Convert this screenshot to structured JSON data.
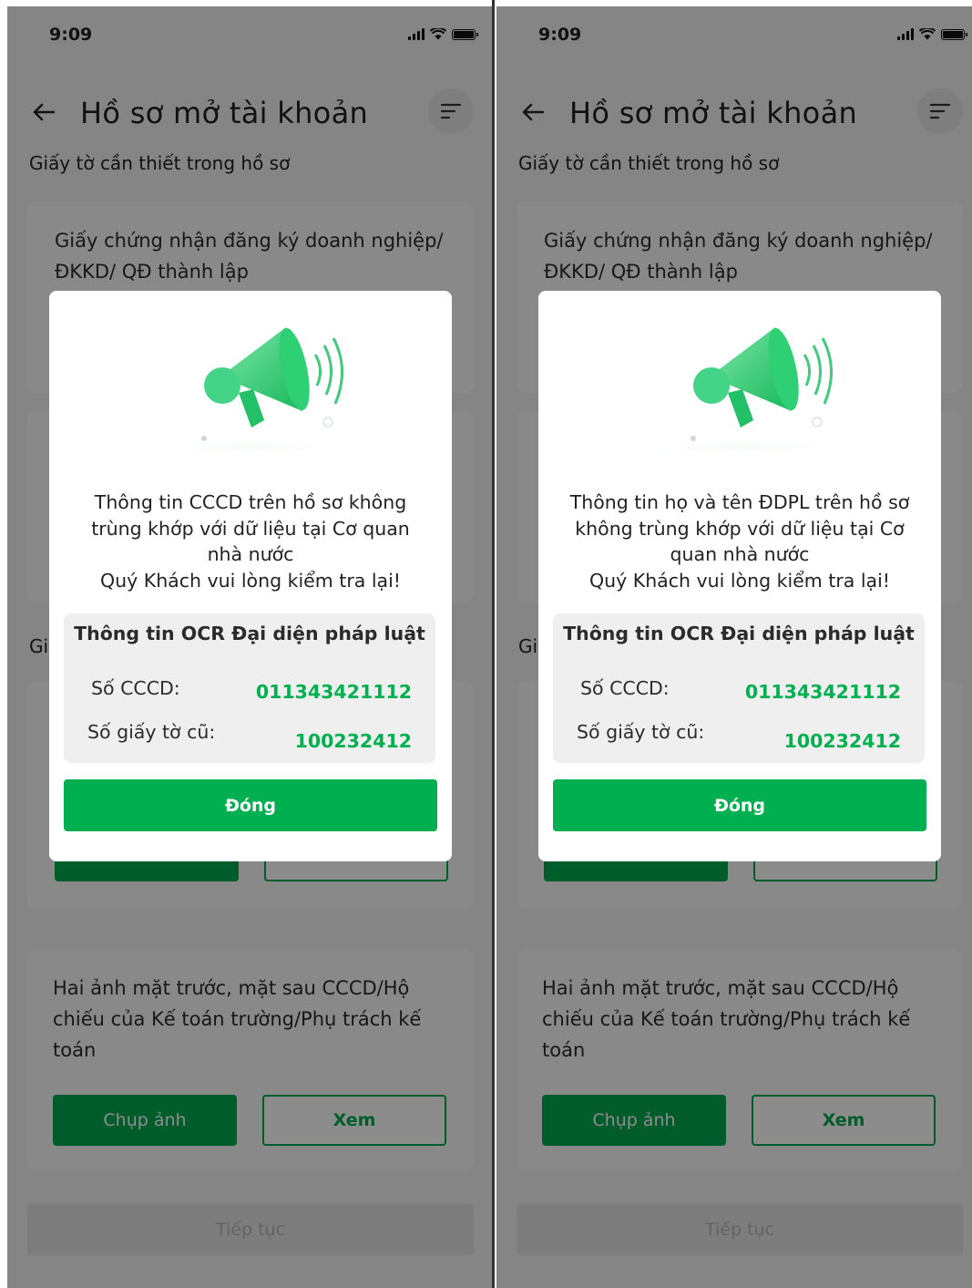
{
  "status": {
    "time": "9:09"
  },
  "header": {
    "title": "Hồ sơ mở tài khoản"
  },
  "section_label": "Giấy tờ cần thiết trong hồ sơ",
  "cards": [
    {
      "text": "Giấy chứng nhận đăng ký doanh nghiệp/ ĐKKD/ QĐ thành lập"
    },
    {
      "text": "Hai ảnh mặt trước, mặt sau CCCD/Hộ chiếu của Kế toán trường/Phụ trách kế toán",
      "capture_label": "Chụp ảnh",
      "view_label": "Xem"
    }
  ],
  "section_label_2_partial": "Gi",
  "continue_label": "Tiếp tục",
  "colors": {
    "primary": "#00b050",
    "dark_primary": "#00a84f"
  },
  "modals": {
    "left": {
      "message_lines": [
        "Thông tin CCCD trên hồ sơ không",
        "trùng khớp với dữ liệu tại Cơ quan",
        "nhà nước",
        "Quý Khách vui lòng kiểm tra lại!"
      ]
    },
    "right": {
      "message_lines": [
        "Thông tin họ và tên ĐDPL trên hồ sơ",
        "không trùng khớp với dữ liệu tại Cơ",
        "quan nhà nước",
        "Quý Khách vui lòng kiểm tra lại!"
      ]
    },
    "info_title": "Thông tin OCR Đại diện pháp luật",
    "cccd_label": "Số CCCD:",
    "cccd_value": "011343421112",
    "old_doc_label": "Số giấy tờ cũ:",
    "old_doc_value": "100232412",
    "close_label": "Đóng"
  }
}
